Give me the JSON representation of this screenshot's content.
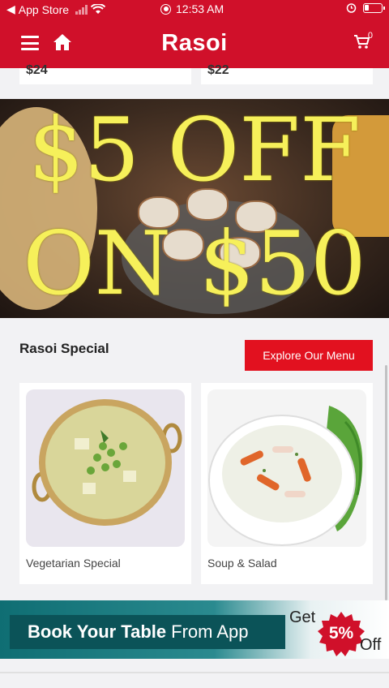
{
  "status_bar": {
    "back_app": "App Store",
    "time": "12:53 AM"
  },
  "header": {
    "title": "Rasoi",
    "cart_count": "0",
    "color": "#d0102a"
  },
  "price_strip": {
    "prices": [
      "$24",
      "$22"
    ]
  },
  "promo": {
    "line1": "$5 OFF",
    "line2": "ON $50",
    "text_color": "#f6f05a"
  },
  "special": {
    "title": "Rasoi Special",
    "explore_label": "Explore Our Menu",
    "button_color": "#e2111f",
    "cards": [
      {
        "label": "Vegetarian Special",
        "image_icon": "vegetable-curry-bowl-image"
      },
      {
        "label": "Soup & Salad",
        "image_icon": "soup-bowl-image"
      }
    ]
  },
  "booking_banner": {
    "bold_text": "Book Your Table",
    "rest_text": "From App",
    "get_text": "Get",
    "percent": "5%",
    "off_text": "Off",
    "badge_color": "#d0102a"
  }
}
